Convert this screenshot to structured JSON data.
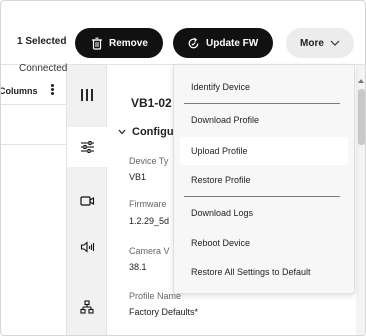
{
  "toolbar": {
    "selected_count": "1 Selected",
    "remove_label": "Remove",
    "update_fw_label": "Update FW",
    "more_label": "More"
  },
  "table": {
    "columns_label": "Columns",
    "row_status": "Connected"
  },
  "rail": {
    "icons": [
      "columns-icon",
      "sliders-icon",
      "video-icon",
      "audio-icon",
      "network-icon"
    ]
  },
  "details": {
    "title": "VB1-02",
    "section_title": "Configu",
    "fields": [
      {
        "label": "Device Ty",
        "value": "VB1"
      },
      {
        "label": "Firmware",
        "value": "1.2.29_5d"
      },
      {
        "label": "Camera V",
        "value": "38.1"
      },
      {
        "label": "Profile Name",
        "value": "Factory Defaults*"
      }
    ]
  },
  "menu": {
    "items": [
      "Identify Device",
      "Download Profile",
      "Upload Profile",
      "Restore Profile",
      "Download Logs",
      "Reboot Device",
      "Restore All Settings to Default"
    ],
    "highlighted": "Upload Profile"
  },
  "colors": {
    "dark_button": "#111111",
    "more_button": "#ececec",
    "rail_bg": "#f1f1f1",
    "menu_bg": "#f7f7f7"
  }
}
